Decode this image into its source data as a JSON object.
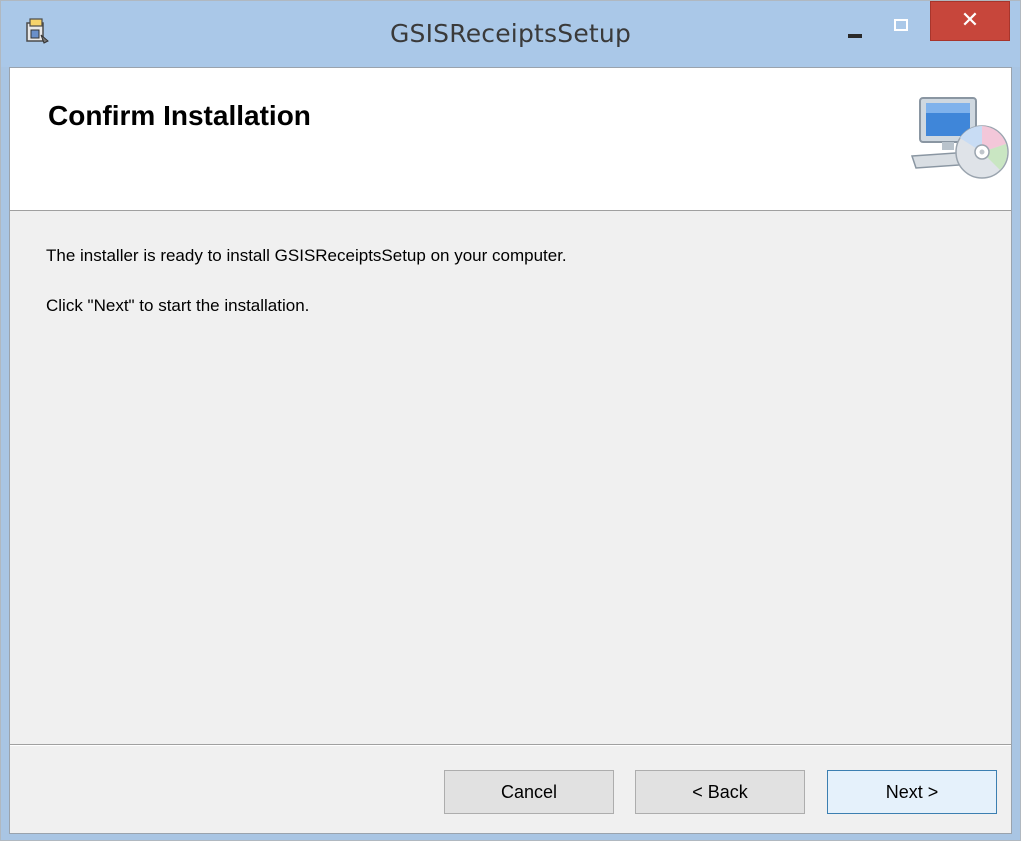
{
  "window": {
    "title": "GSISReceiptsSetup",
    "icon": "installer-icon",
    "controls": {
      "minimize": "minimize-icon",
      "maximize": "maximize-icon",
      "close_label": "✕"
    }
  },
  "banner": {
    "title": "Confirm Installation",
    "icon": "computer-cd-icon"
  },
  "body": {
    "line1": "The installer is ready to install GSISReceiptsSetup on your computer.",
    "line2": "Click \"Next\" to start the installation."
  },
  "buttons": {
    "cancel": "Cancel",
    "back": "< Back",
    "next": "Next >"
  },
  "colors": {
    "titlebar": "#aac8e8",
    "close_button": "#c7463b",
    "default_button_border": "#3c7fb1"
  }
}
